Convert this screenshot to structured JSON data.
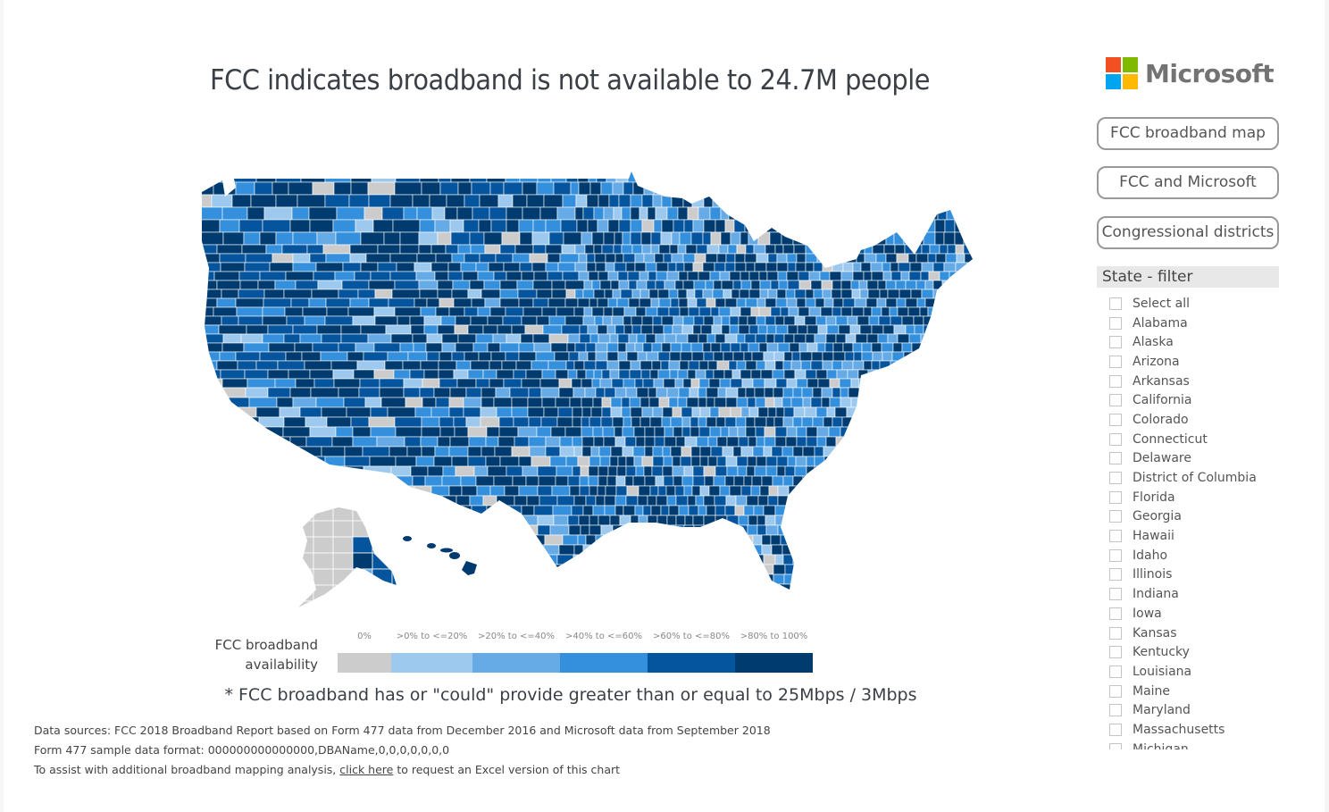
{
  "title": "FCC indicates broadband is not available to 24.7M people",
  "logo": {
    "text": "Microsoft",
    "colors": [
      "#f25022",
      "#7fba00",
      "#00a4ef",
      "#ffb900"
    ]
  },
  "nav_buttons": [
    {
      "label": "FCC broadband map"
    },
    {
      "label": "FCC and Microsoft"
    },
    {
      "label": "Congressional districts"
    }
  ],
  "filter": {
    "header": "State - filter",
    "items": [
      "Select all",
      "Alabama",
      "Alaska",
      "Arizona",
      "Arkansas",
      "California",
      "Colorado",
      "Connecticut",
      "Delaware",
      "District of Columbia",
      "Florida",
      "Georgia",
      "Hawaii",
      "Idaho",
      "Illinois",
      "Indiana",
      "Iowa",
      "Kansas",
      "Kentucky",
      "Louisiana",
      "Maine",
      "Maryland",
      "Massachusetts",
      "Michigan"
    ]
  },
  "legend": {
    "title_line1": "FCC broadband",
    "title_line2": "availability",
    "categories": [
      {
        "label": "0%",
        "color": "#cccccc"
      },
      {
        "label": ">0% to <=20%",
        "color": "#9ec9ef"
      },
      {
        "label": ">20% to <=40%",
        "color": "#66aae6"
      },
      {
        "label": ">40% to <=60%",
        "color": "#3490dc"
      },
      {
        "label": ">60% to <=80%",
        "color": "#05559e"
      },
      {
        "label": ">80% to 100%",
        "color": "#003b6f"
      }
    ]
  },
  "map": {
    "type": "choropleth",
    "geography": "US counties",
    "measure": "FCC broadband availability",
    "regions_shown": [
      "Contiguous US",
      "Alaska",
      "Hawaii"
    ]
  },
  "footnote": "* FCC broadband has or \"could\" provide greater than or equal to 25Mbps / 3Mbps",
  "sources": {
    "line1": "Data sources:  FCC 2018 Broadband Report based on Form 477 data from December 2016 and Microsoft data from September 2018",
    "line2": "Form 477 sample data format: 000000000000000,DBAName,0,0,0,0,0,0,0",
    "line3_prefix": "To assist with additional broadband mapping analysis, ",
    "line3_link": "click here",
    "line3_suffix": " to request an Excel version of this chart"
  }
}
